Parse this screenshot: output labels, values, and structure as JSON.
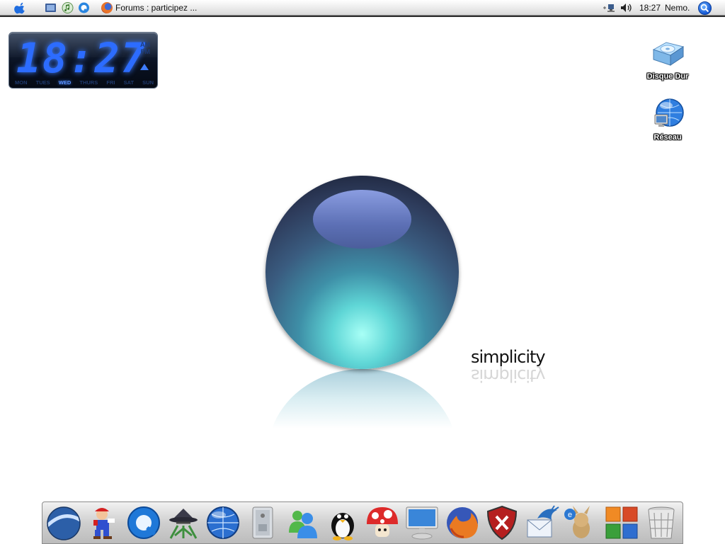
{
  "menubar": {
    "active_window_title": "Forums : participez ...",
    "clock": "18:27",
    "user": "Nemo."
  },
  "widget": {
    "time": "18:27",
    "days": [
      "MON",
      "TUES",
      "WED",
      "THURS",
      "FRI",
      "SAT",
      "SUN"
    ],
    "active_day": "WED",
    "ampm": [
      "AM",
      "PM"
    ]
  },
  "desktop": {
    "icons": [
      {
        "label": "Disque Dur",
        "icon": "hard-drive-icon"
      },
      {
        "label": "Réseau",
        "icon": "network-globe-icon"
      }
    ]
  },
  "wallpaper": {
    "brand_text": "simplicity"
  },
  "dock": {
    "items": [
      {
        "icon": "google-earth-icon"
      },
      {
        "icon": "mario-icon"
      },
      {
        "icon": "quicktime-icon"
      },
      {
        "icon": "spy-agent-icon"
      },
      {
        "icon": "network-globe-icon"
      },
      {
        "icon": "power-mac-icon"
      },
      {
        "icon": "messenger-icon"
      },
      {
        "icon": "linux-penguin-icon"
      },
      {
        "icon": "mushroom-icon"
      },
      {
        "icon": "display-icon"
      },
      {
        "icon": "firefox-icon"
      },
      {
        "icon": "security-shield-icon"
      },
      {
        "icon": "mail-dragon-icon"
      },
      {
        "icon": "emule-icon"
      },
      {
        "icon": "office-icon"
      },
      {
        "icon": "trash-icon"
      }
    ]
  },
  "colors": {
    "widget_digit": "#2c6cff",
    "sphere_glow": "#a8fff6",
    "sphere_edge": "#1a2035"
  }
}
